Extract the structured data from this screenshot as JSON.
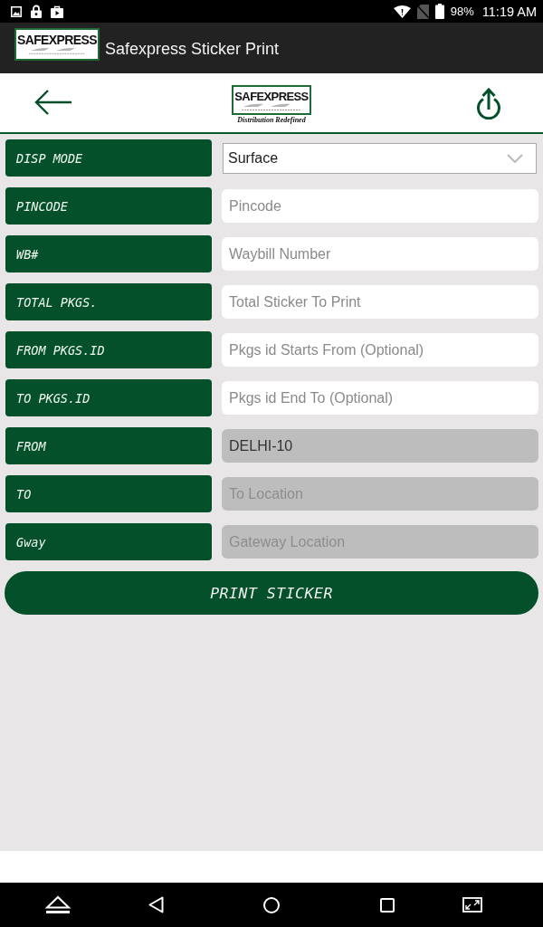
{
  "status_bar": {
    "battery": "98%",
    "time": "11:19 AM"
  },
  "app_bar": {
    "logo": {
      "wordmark": "SAFEXPRESS"
    },
    "title": "Safexpress Sticker Print"
  },
  "header": {
    "logo": {
      "wordmark": "SAFEXPRESS",
      "tagline": "Distribution Redefined"
    }
  },
  "form": {
    "rows": [
      {
        "label": "DISP MODE",
        "kind": "dropdown",
        "value": "Surface"
      },
      {
        "label": "PINCODE",
        "kind": "text",
        "placeholder": "Pincode",
        "disabled": false
      },
      {
        "label": "WB#",
        "kind": "text",
        "placeholder": "Waybill Number",
        "disabled": false
      },
      {
        "label": "TOTAL PKGS.",
        "kind": "text",
        "placeholder": "Total Sticker To Print",
        "disabled": false
      },
      {
        "label": "FROM PKGS.ID",
        "kind": "text",
        "placeholder": "Pkgs id Starts From (Optional)",
        "disabled": false
      },
      {
        "label": "TO PKGS.ID",
        "kind": "text",
        "placeholder": "Pkgs id End To (Optional)",
        "disabled": false
      },
      {
        "label": "FROM",
        "kind": "text",
        "value": "DELHI-10",
        "disabled": true
      },
      {
        "label": "TO",
        "kind": "text",
        "placeholder": "To Location",
        "disabled": true
      },
      {
        "label": "Gway",
        "kind": "text",
        "placeholder": "Gateway Location",
        "disabled": true
      }
    ]
  },
  "print_button": "PRINT STICKER"
}
